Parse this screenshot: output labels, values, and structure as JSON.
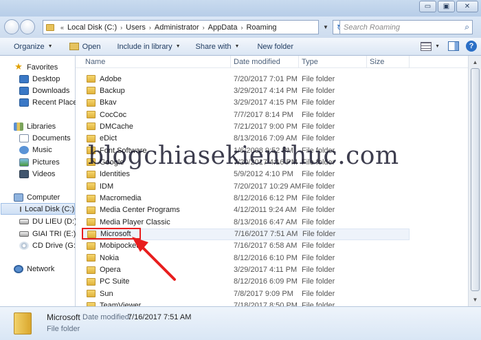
{
  "window": {
    "min_glyph": "▭",
    "max_glyph": "▣",
    "close_glyph": "✕"
  },
  "address_bar": {
    "prefix": "«",
    "crumbs": [
      "Local Disk (C:)",
      "Users",
      "Administrator",
      "AppData",
      "Roaming"
    ],
    "separator": "›",
    "dropdown": "▼",
    "refresh": "↻"
  },
  "search": {
    "placeholder": "Search Roaming",
    "icon": "search-icon"
  },
  "toolbar": {
    "organize": "Organize",
    "open": "Open",
    "include_in_library": "Include in library",
    "share_with": "Share with",
    "new_folder": "New folder",
    "dropdown_arrow": "▼"
  },
  "nav": {
    "favorites": "Favorites",
    "desktop": "Desktop",
    "downloads": "Downloads",
    "recent_places": "Recent Places",
    "libraries": "Libraries",
    "documents": "Documents",
    "music": "Music",
    "pictures": "Pictures",
    "videos": "Videos",
    "computer": "Computer",
    "local_disk": "Local Disk (C:)",
    "du_lieu": "DU LIEU (D:)",
    "giai_tri": "GIAI TRI (E:)",
    "cd_drive": "CD Drive (G:)",
    "network": "Network"
  },
  "columns": {
    "name": "Name",
    "date_modified": "Date modified",
    "type": "Type",
    "size": "Size"
  },
  "files": [
    {
      "name": "Adobe",
      "date": "7/20/2017 7:01 PM",
      "type": "File folder"
    },
    {
      "name": "Backup",
      "date": "3/29/2017 4:14 PM",
      "type": "File folder"
    },
    {
      "name": "Bkav",
      "date": "3/29/2017 4:15 PM",
      "type": "File folder"
    },
    {
      "name": "CocCoc",
      "date": "7/7/2017 8:14 PM",
      "type": "File folder"
    },
    {
      "name": "DMCache",
      "date": "7/21/2017 9:00 PM",
      "type": "File folder"
    },
    {
      "name": "eDict",
      "date": "8/13/2016 7:09 AM",
      "type": "File folder"
    },
    {
      "name": "Font Software",
      "date": "1/6/2008 9:52 PM",
      "type": "File folder"
    },
    {
      "name": "Google",
      "date": "7/20/2017 4:16 PM",
      "type": "File folder"
    },
    {
      "name": "Identities",
      "date": "5/9/2012 4:10 PM",
      "type": "File folder"
    },
    {
      "name": "IDM",
      "date": "7/20/2017 10:29 AM",
      "type": "File folder"
    },
    {
      "name": "Macromedia",
      "date": "8/12/2016 6:12 PM",
      "type": "File folder"
    },
    {
      "name": "Media Center Programs",
      "date": "4/12/2011 9:24 AM",
      "type": "File folder"
    },
    {
      "name": "Media Player Classic",
      "date": "8/13/2016 6:47 AM",
      "type": "File folder"
    },
    {
      "name": "Microsoft",
      "date": "7/16/2017 7:51 AM",
      "type": "File folder"
    },
    {
      "name": "Mobipocket",
      "date": "7/16/2017 6:58 AM",
      "type": "File folder"
    },
    {
      "name": "Nokia",
      "date": "8/12/2016 6:10 PM",
      "type": "File folder"
    },
    {
      "name": "Opera",
      "date": "3/29/2017 4:11 PM",
      "type": "File folder"
    },
    {
      "name": "PC Suite",
      "date": "8/12/2016 6:09 PM",
      "type": "File folder"
    },
    {
      "name": "Sun",
      "date": "7/8/2017 9:09 PM",
      "type": "File folder"
    },
    {
      "name": "TeamViewer",
      "date": "7/18/2017 8:50 PM",
      "type": "File folder"
    }
  ],
  "selected": {
    "name": "Microsoft",
    "modified_label": "Date modified:",
    "modified_value": "7/16/2017 7:51 AM",
    "type": "File folder"
  },
  "watermark": "blogchiasekienthuc.com",
  "colors": {
    "annotation_red": "#e81e1e",
    "selection_blue": "#cfe0f5"
  }
}
